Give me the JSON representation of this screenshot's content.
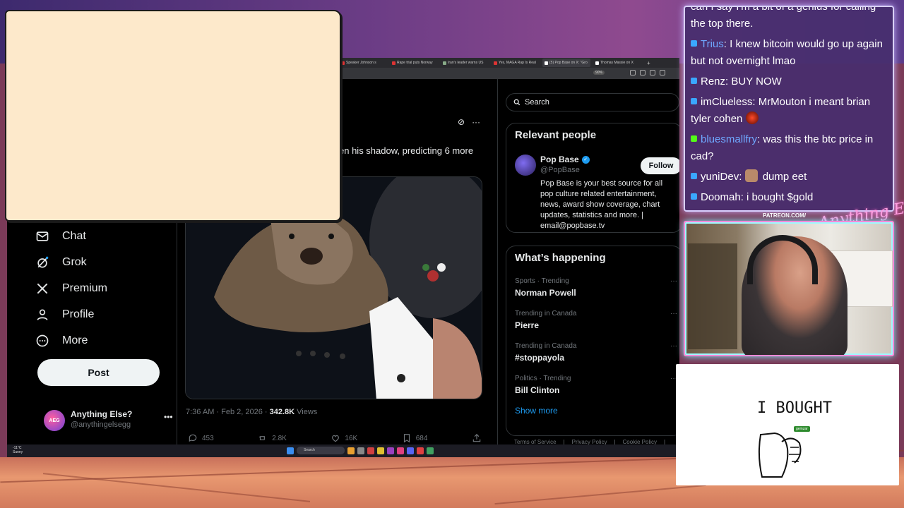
{
  "browser": {
    "tabs": [
      {
        "label": "Speaker Johnson s"
      },
      {
        "label": "Rape trial puts Norway"
      },
      {
        "label": "Iran's leader warns US"
      },
      {
        "label": "Yes, MAGA Rap Is Real"
      },
      {
        "label": "(5) Pop Base on X: \"Gro"
      },
      {
        "label": "Thomas Massie on X"
      }
    ],
    "zoom": "90%"
  },
  "nav": {
    "items": [
      {
        "label": "Chat",
        "icon": "mail-icon"
      },
      {
        "label": "Grok",
        "icon": "grok-icon"
      },
      {
        "label": "Premium",
        "icon": "x-logo-icon"
      },
      {
        "label": "Profile",
        "icon": "person-icon"
      },
      {
        "label": "More",
        "icon": "more-circle-icon"
      }
    ],
    "post_label": "Post"
  },
  "account": {
    "name": "Anything Else?",
    "handle": "@anythingelsegg",
    "avatar_text": "AEG"
  },
  "post": {
    "text": "en his shadow, predicting 6 more",
    "time": "7:36 AM · Feb 2, 2026 · ",
    "views_count": "342.8K",
    "views_label": " Views",
    "replies": "453",
    "reposts": "2.8K",
    "likes": "16K",
    "bookmarks": "684"
  },
  "sidebar": {
    "search_placeholder": "Search",
    "relevant_title": "Relevant people",
    "person": {
      "name": "Pop Base",
      "handle": "@PopBase",
      "follow_label": "Follow",
      "bio": "Pop Base is your best source for all pop culture related entertainment, news, award show coverage, chart updates, statistics and more. | email@popbase.tv"
    },
    "happening_title": "What’s happening",
    "trends": [
      {
        "category": "Sports · Trending",
        "name": "Norman Powell"
      },
      {
        "category": "Trending in Canada",
        "name": "Pierre"
      },
      {
        "category": "Trending in Canada",
        "name": "#stoppayola"
      },
      {
        "category": "Politics · Trending",
        "name": "Bill Clinton"
      }
    ],
    "show_more": "Show more",
    "footer": [
      "Terms of Service",
      "|",
      "Privacy Policy",
      "|",
      "Cookie Policy",
      "|"
    ]
  },
  "taskbar": {
    "weather_temp": "-11°C",
    "weather_desc": "Sunny",
    "search_label": "Search"
  },
  "chat": {
    "messages": [
      {
        "user": "",
        "text": "can I say I'm a bit of a genius for calling the top there.",
        "badge": ""
      },
      {
        "user": "Trius",
        "text": ": I knew bitcoin would go up again but not overnight lmao",
        "badge": "prime",
        "user_color": "blue"
      },
      {
        "user": "Renz",
        "text": ": BUY NOW",
        "badge": "prime",
        "user_color": "white"
      },
      {
        "user": "imClueless",
        "text": ": MrMouton i meant brian tyler cohen",
        "badge": "prime",
        "user_color": "white",
        "emote": true
      },
      {
        "user": "bluesmallfry",
        "text": ": was this the btc price in cad?",
        "badge": "kick",
        "user_color": "blue"
      },
      {
        "user": "yuniDev",
        "text": " dump eet",
        "badge": "prime",
        "user_color": "white",
        "emote2": true
      },
      {
        "user": "Doomah",
        "text": ": i bought $gold",
        "badge": "prime",
        "user_color": "white"
      }
    ]
  },
  "overlay": {
    "patreon": "PATREON.COM/",
    "logo": "Anything Else?",
    "drawing_text": "I  BOUGHT",
    "drawing_tag": "gemzar"
  }
}
